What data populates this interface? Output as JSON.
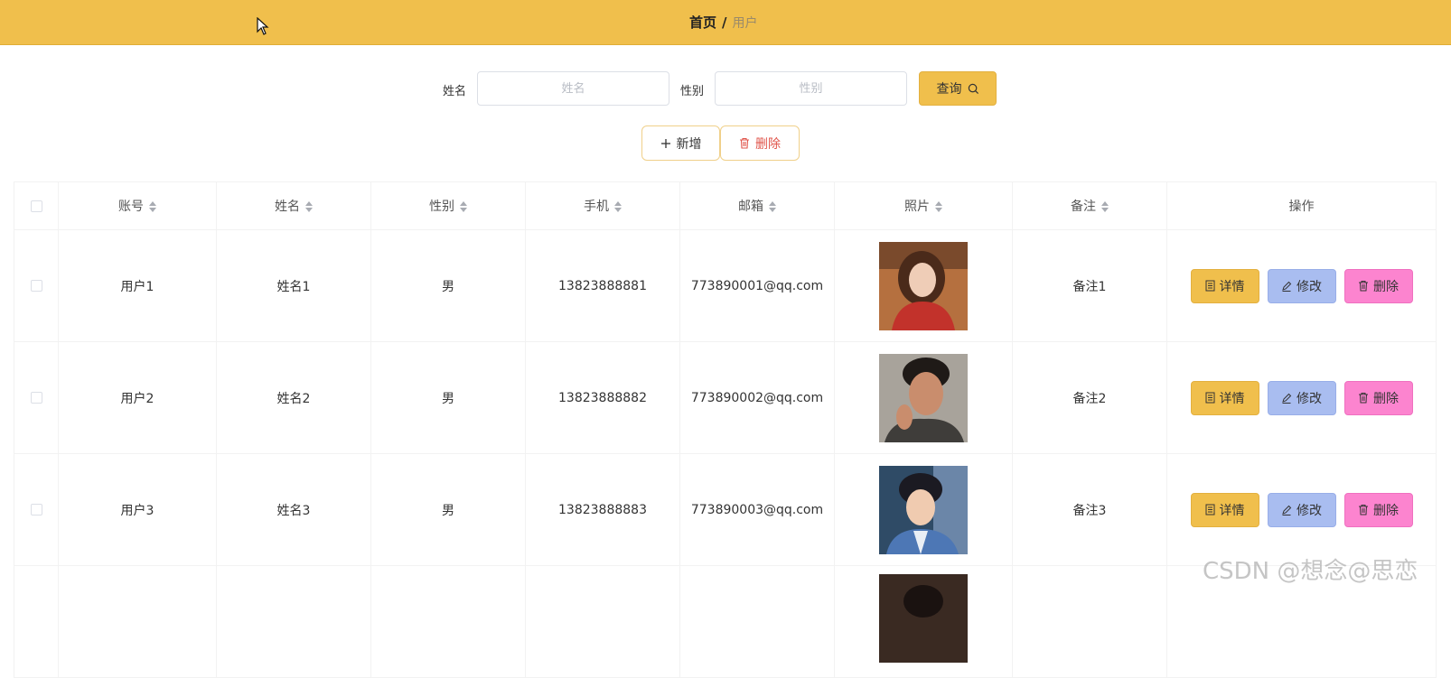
{
  "breadcrumb": {
    "home": "首页",
    "separator": "/",
    "current": "用户"
  },
  "search": {
    "name_label": "姓名",
    "name_placeholder": "姓名",
    "name_value": "",
    "gender_label": "性别",
    "gender_placeholder": "性别",
    "gender_value": "",
    "query_label": "查询"
  },
  "actions": {
    "add_label": "新增",
    "delete_label": "删除"
  },
  "table": {
    "columns": [
      "账号",
      "姓名",
      "性别",
      "手机",
      "邮箱",
      "照片",
      "备注",
      "操作"
    ],
    "rows": [
      {
        "account": "用户1",
        "name": "姓名1",
        "gender": "男",
        "phone": "13823888881",
        "email": "773890001@qq.com",
        "remark": "备注1"
      },
      {
        "account": "用户2",
        "name": "姓名2",
        "gender": "男",
        "phone": "13823888882",
        "email": "773890002@qq.com",
        "remark": "备注2"
      },
      {
        "account": "用户3",
        "name": "姓名3",
        "gender": "男",
        "phone": "13823888883",
        "email": "773890003@qq.com",
        "remark": "备注3"
      }
    ],
    "row_actions": {
      "detail": "详情",
      "edit": "修改",
      "delete": "删除"
    }
  },
  "watermark": "CSDN @想念@思恋",
  "colors": {
    "primary": "#f0bf4c",
    "edit": "#a9bdf0",
    "delete": "#fc84cf",
    "danger_text": "#e0554b"
  }
}
